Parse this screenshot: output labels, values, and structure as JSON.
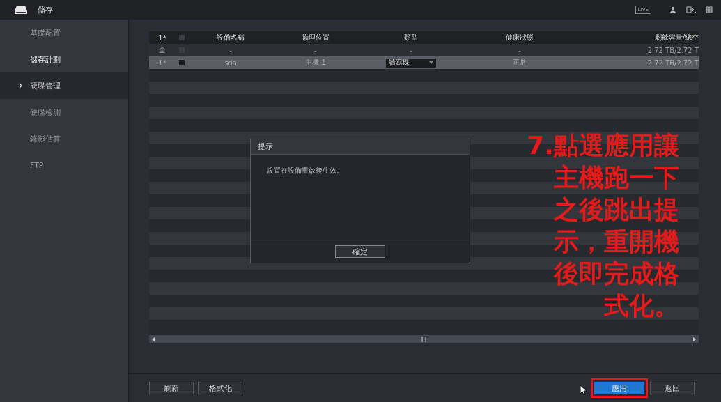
{
  "window": {
    "title": "儲存",
    "live_badge": "LIVE"
  },
  "sidebar": {
    "items": [
      {
        "label": "基礎配置",
        "selected": false,
        "hovered": false
      },
      {
        "label": "儲存計劃",
        "selected": false,
        "hovered": true
      },
      {
        "label": "硬碟管理",
        "selected": true,
        "hovered": false
      },
      {
        "label": "硬碟檢測",
        "selected": false,
        "hovered": false
      },
      {
        "label": "錄影估算",
        "selected": false,
        "hovered": false
      },
      {
        "label": "FTP",
        "selected": false,
        "hovered": false
      }
    ]
  },
  "table": {
    "header_checked": false,
    "columns": [
      "1*",
      "設備名稱",
      "物理位置",
      "類型",
      "健康狀態",
      "剩餘容量/總空"
    ],
    "rows": [
      {
        "index": "全",
        "name": "-",
        "location": "-",
        "type": "-",
        "kind": "text",
        "checked": false,
        "health": "-",
        "capacity": "2.72 TB/2.72 T",
        "selected": false
      },
      {
        "index": "1*",
        "name": "sda",
        "location": "主機-1",
        "type": "讀寫碟",
        "kind": "dropdown",
        "checked": false,
        "health": "正常",
        "capacity": "2.72 TB/2.72 T",
        "selected": true
      }
    ]
  },
  "dialog": {
    "title": "提示",
    "message": "設置在設備重啟後生效。",
    "ok_button": "確定"
  },
  "buttons": [
    {
      "label": "刷新",
      "primary": false,
      "highlighted": false
    },
    {
      "label": "格式化",
      "primary": false,
      "highlighted": false
    },
    {
      "label": "應用",
      "primary": true,
      "highlighted": true
    },
    {
      "label": "返回",
      "primary": false,
      "highlighted": false
    }
  ],
  "annotation": {
    "lines": [
      "7.點選應用讓",
      "主機跑一下",
      "之後跳出提",
      "示，重開機",
      "後即完成格",
      "式化。"
    ]
  }
}
